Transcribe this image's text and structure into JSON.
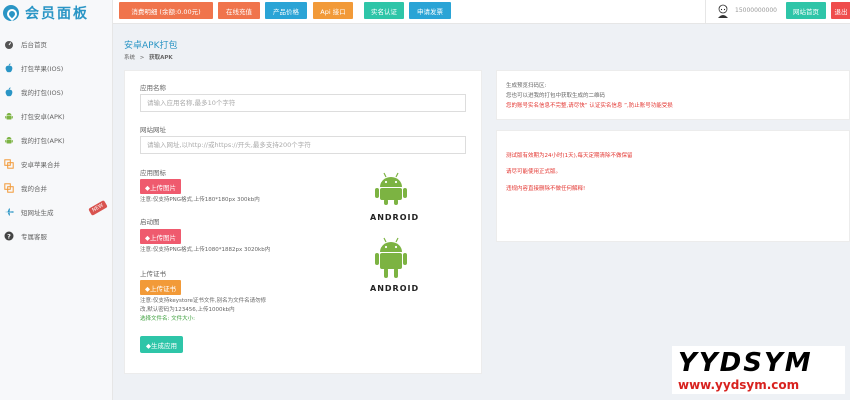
{
  "logo": {
    "text": "会员面板"
  },
  "sidebar": {
    "items": [
      {
        "label": "后台首页",
        "icon": "dashboard-icon"
      },
      {
        "label": "打包苹果(IOS)",
        "icon": "apple-icon"
      },
      {
        "label": "我的打包(IOS)",
        "icon": "apple-icon"
      },
      {
        "label": "打包安卓(APK)",
        "icon": "android-icon"
      },
      {
        "label": "我的打包(APK)",
        "icon": "android-icon"
      },
      {
        "label": "安卓苹果合并",
        "icon": "merge-icon"
      },
      {
        "label": "我的合并",
        "icon": "merge-icon"
      },
      {
        "label": "短网址生成",
        "icon": "plane-icon",
        "badge": "NEW"
      },
      {
        "label": "专属客服",
        "icon": "help-icon"
      }
    ]
  },
  "topbar": {
    "buttons": [
      {
        "label": "消费明细 (余额:0.00元)",
        "color": "#f0744c"
      },
      {
        "label": "在线充值",
        "color": "#f0744c"
      },
      {
        "label": "产品价格",
        "color": "#2aa4d6"
      },
      {
        "label": "Api 接口",
        "color": "#f29a38"
      },
      {
        "label": "实名认证",
        "color": "#2ec5a8"
      },
      {
        "label": "申请发票",
        "color": "#2aa4d6"
      }
    ],
    "phone": "15000000000",
    "home_label": "网站首页",
    "logout_label": "退出",
    "home_color": "#2ec5a8",
    "logout_color": "#ef4d4d"
  },
  "page": {
    "title": "安卓APK打包",
    "breadcrumb_home": "系统",
    "breadcrumb_sep": ">",
    "breadcrumb_current": "获取APK"
  },
  "form": {
    "app_name_label": "应用名称",
    "app_name_placeholder": "请输入应用名称,最多10个字符",
    "site_url_label": "网站网址",
    "site_url_placeholder": "请输入网址,以http://或https://开头,最多支持200个字符",
    "icon_label": "应用图标",
    "icon_upload": "◆上传图片",
    "icon_note": "注意:仅支持PNG格式,上传180*180px 300kb内",
    "splash_label": "启动图",
    "splash_upload": "◆上传图片",
    "splash_note": "注意:仅支持PNG格式,上传1080*1882px 3020kb内",
    "cert_label": "上传证书",
    "cert_upload": "◆上传证书",
    "cert_note_1": "注意:仅支持keystore证书文件,别名为文件名请勿修",
    "cert_note_2": "改,默认密码为123456,上传1000kb内",
    "cert_selected": "选择文件名: 文件大小:",
    "generate_button": "◆生成应用",
    "android_text": "ANDROID",
    "upload_color": "#ef5a6e",
    "cert_color": "#f29a38"
  },
  "info": {
    "qr_title": "生成预览扫码区:",
    "qr_desc": "您也可以进我的打包中获取生成的二维码",
    "qr_warn": "您的账号实名信息不完整,请尽快“ 认证实名信息 ”,防止账号功能受损",
    "notice_1": "测试版有效期为24小时(1天),每天定期清除不做保留",
    "notice_2": "请尽可能使用正式版。",
    "notice_3": "违规内容直接删除不做任何解释!"
  },
  "watermark": {
    "big": "YYDSYM",
    "small": "www.yydsym.com"
  }
}
